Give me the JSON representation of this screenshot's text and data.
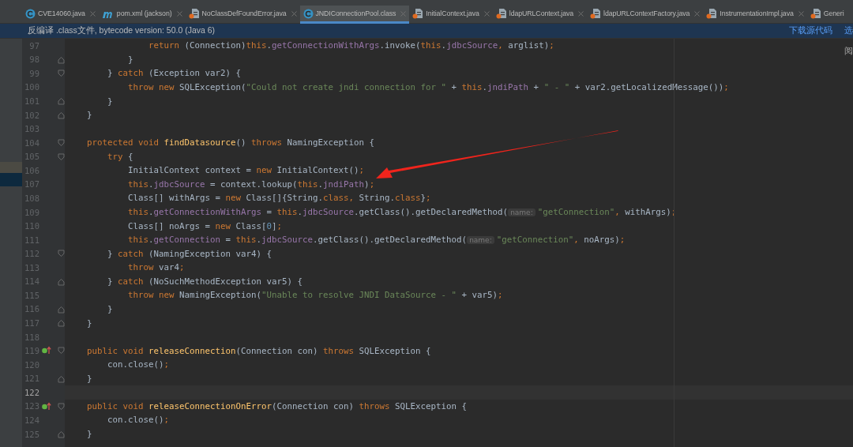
{
  "tabs": [
    {
      "label": "CVE14060.java",
      "kind": "class",
      "selected": false
    },
    {
      "label": "pom.xml (jackson)",
      "kind": "maven",
      "selected": false
    },
    {
      "label": "NoClassDefFoundError.java",
      "kind": "decompiled",
      "selected": false
    },
    {
      "label": "JNDIConnectionPool.class",
      "kind": "class",
      "selected": true
    },
    {
      "label": "InitialContext.java",
      "kind": "decompiled",
      "selected": false
    },
    {
      "label": "ldapURLContext.java",
      "kind": "decompiled",
      "selected": false
    },
    {
      "label": "ldapURLContextFactory.java",
      "kind": "decompiled",
      "selected": false
    },
    {
      "label": "InstrumentationImpl.java",
      "kind": "decompiled",
      "selected": false
    },
    {
      "label": "Generi",
      "kind": "decompiled",
      "selected": false
    }
  ],
  "banner": {
    "message": "反编译 .class文件, bytecode version: 50.0 (Java 6)",
    "links": [
      "下载源代码",
      "选"
    ]
  },
  "side_label": "阅",
  "sidebar": {
    "rows": [
      {
        "selected": false
      },
      {
        "selected": true
      }
    ]
  },
  "editor": {
    "lines": [
      {
        "number": "97",
        "kind": "plain",
        "implements": false,
        "current": false,
        "tokens": [
          {
            "kind": "keyword",
            "text": "                return "
          },
          {
            "kind": "plain",
            "text": "(Connection)"
          },
          {
            "kind": "keyword",
            "text": "this"
          },
          {
            "kind": "plain",
            "text": "."
          },
          {
            "kind": "field",
            "text": "getConnectionWithArgs"
          },
          {
            "kind": "plain",
            "text": ".invoke("
          },
          {
            "kind": "keyword",
            "text": "this"
          },
          {
            "kind": "plain",
            "text": "."
          },
          {
            "kind": "field",
            "text": "jdbcSource"
          },
          {
            "kind": "keyword",
            "text": ", "
          },
          {
            "kind": "plain",
            "text": "arglist)"
          },
          {
            "kind": "keyword",
            "text": ";"
          }
        ]
      },
      {
        "number": "98",
        "kind": "fold-end",
        "implements": false,
        "current": false,
        "tokens": [
          {
            "kind": "plain",
            "text": "            }"
          }
        ]
      },
      {
        "number": "99",
        "kind": "fold-start",
        "implements": false,
        "current": false,
        "tokens": [
          {
            "kind": "plain",
            "text": "        } "
          },
          {
            "kind": "keyword",
            "text": "catch "
          },
          {
            "kind": "plain",
            "text": "(Exception var2) {"
          }
        ]
      },
      {
        "number": "100",
        "kind": "plain",
        "implements": false,
        "current": false,
        "tokens": [
          {
            "kind": "keyword",
            "text": "            throw new "
          },
          {
            "kind": "plain",
            "text": "SQLException("
          },
          {
            "kind": "string",
            "text": "\"Could not create jndi connection for \" "
          },
          {
            "kind": "plain",
            "text": "+ "
          },
          {
            "kind": "keyword",
            "text": "this"
          },
          {
            "kind": "plain",
            "text": "."
          },
          {
            "kind": "field",
            "text": "jndiPath "
          },
          {
            "kind": "plain",
            "text": "+ "
          },
          {
            "kind": "string",
            "text": "\" - \" "
          },
          {
            "kind": "plain",
            "text": "+ var2.getLocalizedMessage())"
          },
          {
            "kind": "keyword",
            "text": ";"
          }
        ]
      },
      {
        "number": "101",
        "kind": "fold-end",
        "implements": false,
        "current": false,
        "tokens": [
          {
            "kind": "plain",
            "text": "        }"
          }
        ]
      },
      {
        "number": "102",
        "kind": "fold-end",
        "implements": false,
        "current": false,
        "tokens": [
          {
            "kind": "plain",
            "text": "    }"
          }
        ]
      },
      {
        "number": "103",
        "kind": "plain",
        "implements": false,
        "current": false
      },
      {
        "number": "104",
        "kind": "fold-start",
        "implements": false,
        "current": false,
        "tokens": [
          {
            "kind": "keyword",
            "text": "    protected void "
          },
          {
            "kind": "declaration",
            "text": "findDatasource"
          },
          {
            "kind": "plain",
            "text": "() "
          },
          {
            "kind": "keyword",
            "text": "throws "
          },
          {
            "kind": "plain",
            "text": "NamingException {"
          }
        ]
      },
      {
        "number": "105",
        "kind": "fold-start",
        "implements": false,
        "current": false,
        "tokens": [
          {
            "kind": "keyword",
            "text": "        try "
          },
          {
            "kind": "plain",
            "text": "{"
          }
        ]
      },
      {
        "number": "106",
        "kind": "plain",
        "implements": false,
        "current": false,
        "tokens": [
          {
            "kind": "plain",
            "text": "            InitialContext context = "
          },
          {
            "kind": "keyword",
            "text": "new "
          },
          {
            "kind": "plain",
            "text": "InitialContext()"
          },
          {
            "kind": "keyword",
            "text": ";"
          }
        ]
      },
      {
        "number": "107",
        "kind": "plain",
        "implements": false,
        "current": false,
        "tokens": [
          {
            "kind": "keyword",
            "text": "            this"
          },
          {
            "kind": "plain",
            "text": "."
          },
          {
            "kind": "field",
            "text": "jdbcSource "
          },
          {
            "kind": "plain",
            "text": "= context.lookup("
          },
          {
            "kind": "keyword",
            "text": "this"
          },
          {
            "kind": "plain",
            "text": "."
          },
          {
            "kind": "field",
            "text": "jndiPath"
          },
          {
            "kind": "plain",
            "text": ")"
          },
          {
            "kind": "keyword",
            "text": ";"
          }
        ]
      },
      {
        "number": "108",
        "kind": "plain",
        "implements": false,
        "current": false,
        "tokens": [
          {
            "kind": "plain",
            "text": "            Class[] withArgs = "
          },
          {
            "kind": "keyword",
            "text": "new "
          },
          {
            "kind": "plain",
            "text": "Class[]{String."
          },
          {
            "kind": "keyword",
            "text": "class, "
          },
          {
            "kind": "plain",
            "text": "String."
          },
          {
            "kind": "keyword",
            "text": "class"
          },
          {
            "kind": "plain",
            "text": "}"
          },
          {
            "kind": "keyword",
            "text": ";"
          }
        ]
      },
      {
        "number": "109",
        "kind": "plain",
        "implements": false,
        "current": false,
        "tokens": [
          {
            "kind": "keyword",
            "text": "            this"
          },
          {
            "kind": "plain",
            "text": "."
          },
          {
            "kind": "field",
            "text": "getConnectionWithArgs "
          },
          {
            "kind": "plain",
            "text": "= "
          },
          {
            "kind": "keyword",
            "text": "this"
          },
          {
            "kind": "plain",
            "text": "."
          },
          {
            "kind": "field",
            "text": "jdbcSource"
          },
          {
            "kind": "plain",
            "text": ".getClass().getDeclaredMethod("
          },
          {
            "kind": "hint",
            "text": "name:"
          },
          {
            "kind": "string",
            "text": "\"getConnection\""
          },
          {
            "kind": "keyword",
            "text": ", "
          },
          {
            "kind": "plain",
            "text": "withArgs)"
          },
          {
            "kind": "keyword",
            "text": ";"
          }
        ]
      },
      {
        "number": "110",
        "kind": "plain",
        "implements": false,
        "current": false,
        "tokens": [
          {
            "kind": "plain",
            "text": "            Class[] noArgs = "
          },
          {
            "kind": "keyword",
            "text": "new "
          },
          {
            "kind": "plain",
            "text": "Class["
          },
          {
            "kind": "number",
            "text": "0"
          },
          {
            "kind": "plain",
            "text": "]"
          },
          {
            "kind": "keyword",
            "text": ";"
          }
        ]
      },
      {
        "number": "111",
        "kind": "plain",
        "implements": false,
        "current": false,
        "tokens": [
          {
            "kind": "keyword",
            "text": "            this"
          },
          {
            "kind": "plain",
            "text": "."
          },
          {
            "kind": "field",
            "text": "getConnection "
          },
          {
            "kind": "plain",
            "text": "= "
          },
          {
            "kind": "keyword",
            "text": "this"
          },
          {
            "kind": "plain",
            "text": "."
          },
          {
            "kind": "field",
            "text": "jdbcSource"
          },
          {
            "kind": "plain",
            "text": ".getClass().getDeclaredMethod("
          },
          {
            "kind": "hint",
            "text": "name:"
          },
          {
            "kind": "string",
            "text": "\"getConnection\""
          },
          {
            "kind": "keyword",
            "text": ", "
          },
          {
            "kind": "plain",
            "text": "noArgs)"
          },
          {
            "kind": "keyword",
            "text": ";"
          }
        ]
      },
      {
        "number": "112",
        "kind": "fold-start",
        "implements": false,
        "current": false,
        "tokens": [
          {
            "kind": "plain",
            "text": "        } "
          },
          {
            "kind": "keyword",
            "text": "catch "
          },
          {
            "kind": "plain",
            "text": "(NamingException var4) {"
          }
        ]
      },
      {
        "number": "113",
        "kind": "plain",
        "implements": false,
        "current": false,
        "tokens": [
          {
            "kind": "keyword",
            "text": "            throw "
          },
          {
            "kind": "plain",
            "text": "var4"
          },
          {
            "kind": "keyword",
            "text": ";"
          }
        ]
      },
      {
        "number": "114",
        "kind": "fold-end",
        "implements": false,
        "current": false,
        "tokens": [
          {
            "kind": "plain",
            "text": "        } "
          },
          {
            "kind": "keyword",
            "text": "catch "
          },
          {
            "kind": "plain",
            "text": "(NoSuchMethodException var5) {"
          }
        ]
      },
      {
        "number": "115",
        "kind": "plain",
        "implements": false,
        "current": false,
        "tokens": [
          {
            "kind": "keyword",
            "text": "            throw new "
          },
          {
            "kind": "plain",
            "text": "NamingException("
          },
          {
            "kind": "string",
            "text": "\"Unable to resolve JNDI DataSource - \" "
          },
          {
            "kind": "plain",
            "text": "+ var5)"
          },
          {
            "kind": "keyword",
            "text": ";"
          }
        ]
      },
      {
        "number": "116",
        "kind": "fold-end",
        "implements": false,
        "current": false,
        "tokens": [
          {
            "kind": "plain",
            "text": "        }"
          }
        ]
      },
      {
        "number": "117",
        "kind": "fold-end",
        "implements": false,
        "current": false,
        "tokens": [
          {
            "kind": "plain",
            "text": "    }"
          }
        ]
      },
      {
        "number": "118",
        "kind": "plain",
        "implements": false,
        "current": false
      },
      {
        "number": "119",
        "kind": "fold-start",
        "implements": true,
        "current": false,
        "tokens": [
          {
            "kind": "keyword",
            "text": "    public void "
          },
          {
            "kind": "declaration",
            "text": "releaseConnection"
          },
          {
            "kind": "plain",
            "text": "(Connection con) "
          },
          {
            "kind": "keyword",
            "text": "throws "
          },
          {
            "kind": "plain",
            "text": "SQLException {"
          }
        ]
      },
      {
        "number": "120",
        "kind": "plain",
        "implements": false,
        "current": false,
        "tokens": [
          {
            "kind": "plain",
            "text": "        con.close()"
          },
          {
            "kind": "keyword",
            "text": ";"
          }
        ]
      },
      {
        "number": "121",
        "kind": "fold-end",
        "implements": false,
        "current": false,
        "tokens": [
          {
            "kind": "plain",
            "text": "    }"
          }
        ]
      },
      {
        "number": "122",
        "kind": "plain",
        "implements": false,
        "current": true
      },
      {
        "number": "123",
        "kind": "fold-start",
        "implements": true,
        "current": false,
        "tokens": [
          {
            "kind": "keyword",
            "text": "    public void "
          },
          {
            "kind": "declaration",
            "text": "releaseConnectionOnError"
          },
          {
            "kind": "plain",
            "text": "(Connection con) "
          },
          {
            "kind": "keyword",
            "text": "throws "
          },
          {
            "kind": "plain",
            "text": "SQLException {"
          }
        ]
      },
      {
        "number": "124",
        "kind": "plain",
        "implements": false,
        "current": false,
        "tokens": [
          {
            "kind": "plain",
            "text": "        con.close()"
          },
          {
            "kind": "keyword",
            "text": ";"
          }
        ]
      },
      {
        "number": "125",
        "kind": "fold-end",
        "implements": false,
        "current": false,
        "tokens": [
          {
            "kind": "plain",
            "text": "    }"
          }
        ]
      }
    ]
  }
}
